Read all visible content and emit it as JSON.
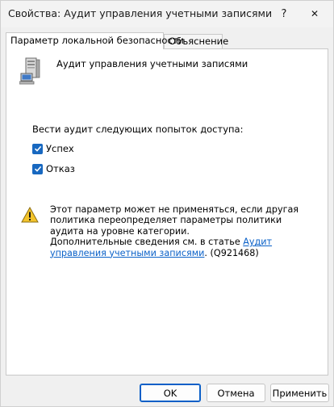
{
  "window": {
    "title": "Свойства: Аудит управления учетными записями",
    "help_glyph": "?",
    "close_glyph": "✕"
  },
  "tabs": [
    {
      "label": "Параметр локальной безопасности",
      "active": true
    },
    {
      "label": "Объяснение",
      "active": false
    }
  ],
  "policy": {
    "icon": "server-computer-icon",
    "name": "Аудит управления учетными записями"
  },
  "audit": {
    "label": "Вести аудит следующих попыток доступа:",
    "options": [
      {
        "label": "Успех",
        "checked": true
      },
      {
        "label": "Отказ",
        "checked": true
      }
    ]
  },
  "warning": {
    "icon": "warning-triangle-icon",
    "text": "Этот параметр может не применяться, если другая политика переопределяет параметры политики аудита на уровне категории.",
    "more_prefix": "Дополнительные сведения см. в статье ",
    "link_text": "Аудит управления учетными записями",
    "more_suffix": ". (Q921468)"
  },
  "buttons": {
    "ok": "OK",
    "cancel": "Отмена",
    "apply": "Применить"
  },
  "colors": {
    "accent": "#1868c0",
    "link": "#0a61c8",
    "warning": "#f4c42b"
  }
}
